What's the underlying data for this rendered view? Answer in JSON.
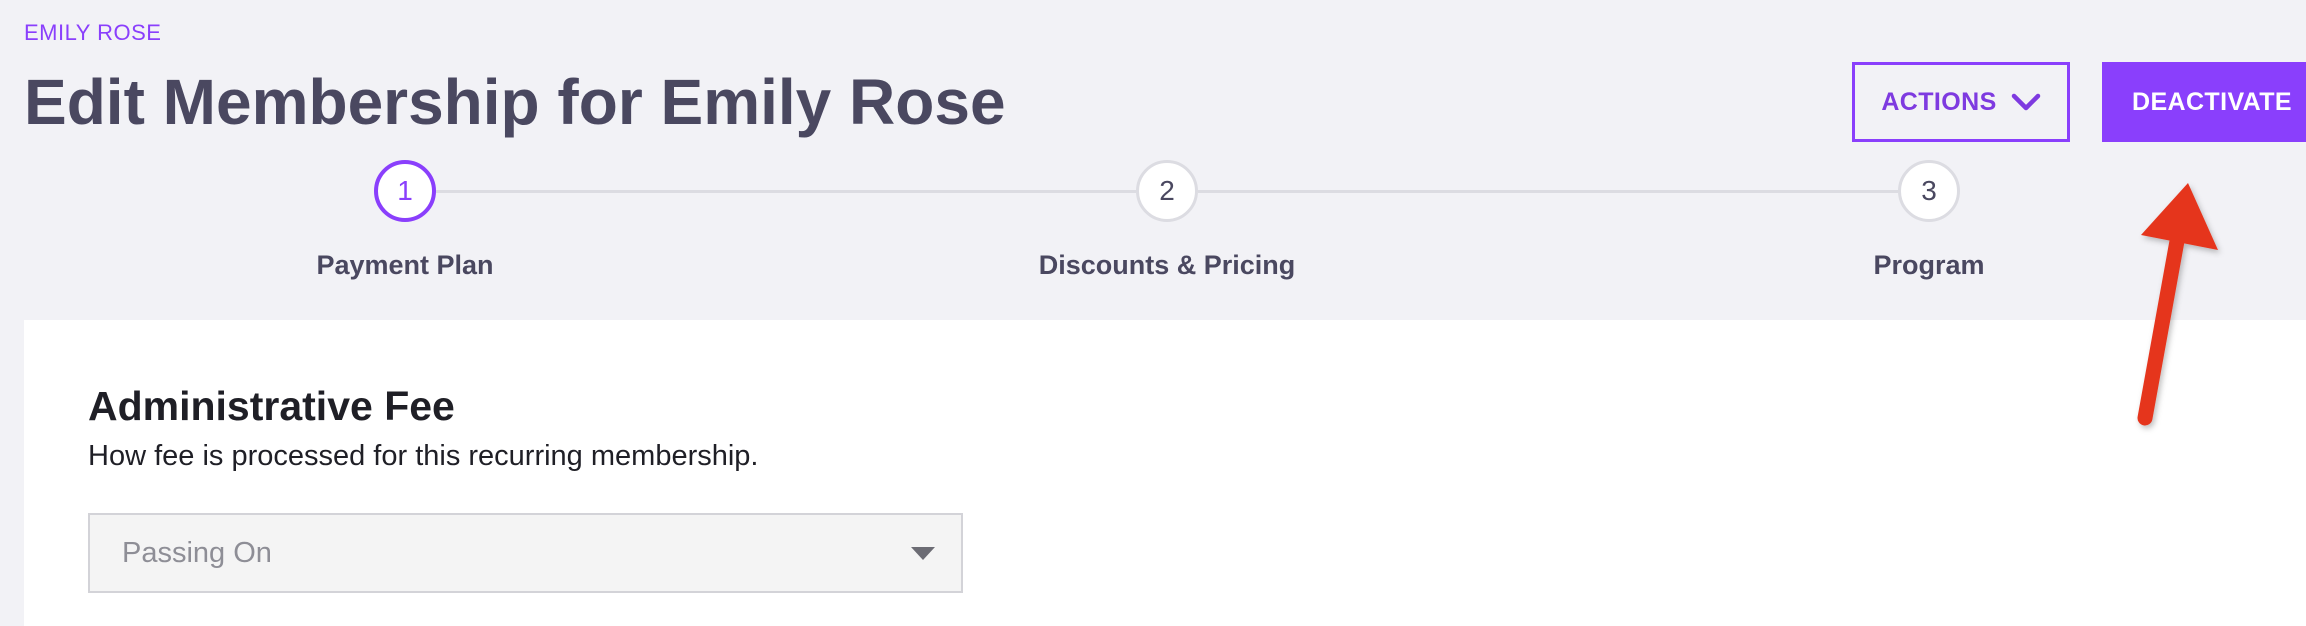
{
  "breadcrumb": "EMILY ROSE",
  "page_title": "Edit Membership for Emily Rose",
  "header": {
    "actions_label": "ACTIONS",
    "actions_icon": "chevron-down-icon",
    "deactivate_label": "DEACTIVATE"
  },
  "stepper": {
    "steps": [
      {
        "number": "1",
        "label": "Payment Plan",
        "state": "active"
      },
      {
        "number": "2",
        "label": "Discounts & Pricing",
        "state": "inactive"
      },
      {
        "number": "3",
        "label": "Program",
        "state": "inactive"
      }
    ]
  },
  "admin_fee": {
    "title": "Administrative Fee",
    "description": "How fee is processed for this recurring membership.",
    "selected": "Passing On"
  },
  "annotation": {
    "arrow_color": "#e5361f",
    "points_to": "deactivate-button"
  },
  "colors": {
    "accent": "#8a3ffc",
    "background": "#f2f2f6",
    "title_text": "#4a4860"
  }
}
